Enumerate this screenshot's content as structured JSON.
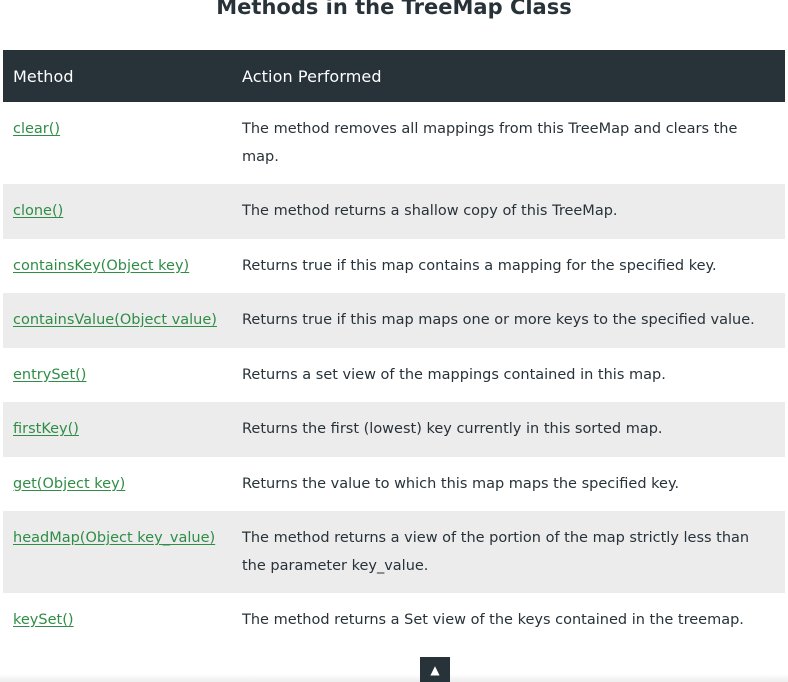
{
  "heading": "Methods in the TreeMap Class",
  "table": {
    "headers": [
      "Method",
      "Action Performed"
    ],
    "rows": [
      {
        "method": "clear()",
        "action": "The method removes all mappings from this TreeMap and clears the map."
      },
      {
        "method": "clone()",
        "action": "The method returns a shallow copy of this TreeMap."
      },
      {
        "method": "containsKey(Object key)",
        "action": "Returns true if this map contains a mapping for the specified key."
      },
      {
        "method": "containsValue(Object value)",
        "action": "Returns true if this map maps one or more keys to the specified value."
      },
      {
        "method": "entrySet()",
        "action": "Returns a set view of the mappings contained in this map."
      },
      {
        "method": "firstKey()",
        "action": "Returns the first (lowest) key currently in this sorted map."
      },
      {
        "method": "get(Object key)",
        "action": "Returns the value to which this map maps the specified key."
      },
      {
        "method": "headMap(Object key_value)",
        "action": "The method returns a view of the portion of the map strictly less than the parameter key_value."
      },
      {
        "method": "keySet()",
        "action": "The method returns a Set view of the keys contained in the treemap."
      }
    ]
  },
  "scroll_top": {
    "icon": "arrow-up-icon",
    "glyph": "▲"
  },
  "colors": {
    "header_bg": "#273239",
    "link": "#2f8d46",
    "stripe": "#ececec",
    "text": "#273239"
  }
}
